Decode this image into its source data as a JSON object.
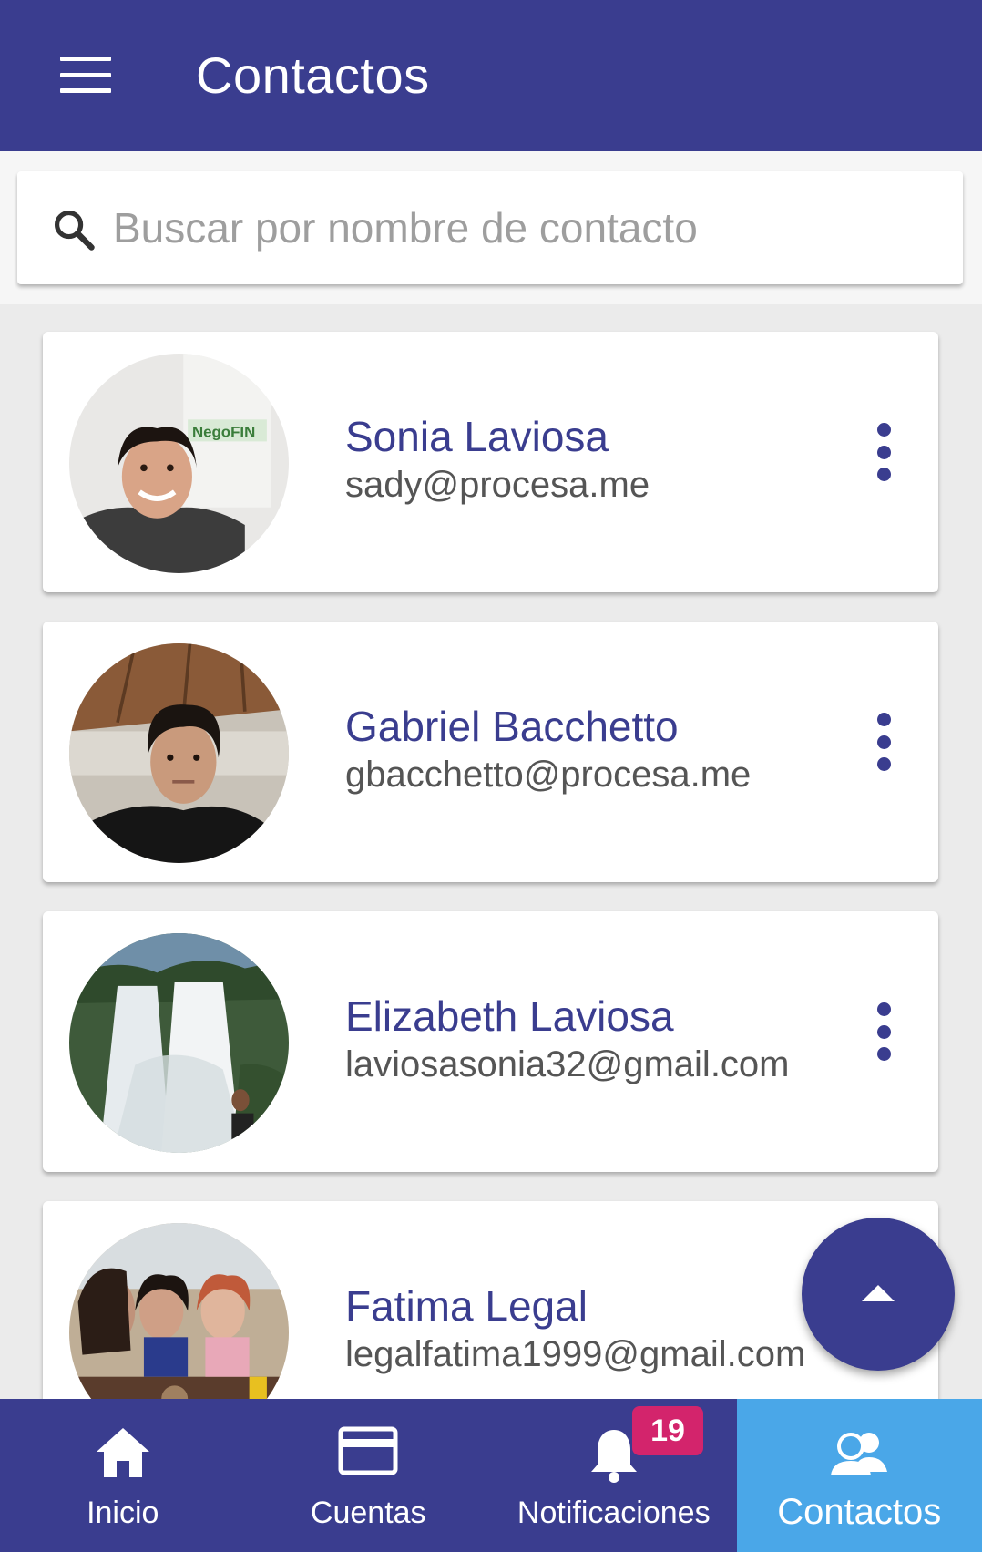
{
  "header": {
    "title": "Contactos",
    "menu_icon": "hamburger-menu-icon"
  },
  "search": {
    "placeholder": "Buscar por nombre de contacto",
    "value": "",
    "icon": "search-icon"
  },
  "contacts": [
    {
      "name": "Sonia Laviosa",
      "email": "sady@procesa.me"
    },
    {
      "name": "Gabriel Bacchetto",
      "email": "gbacchetto@procesa.me"
    },
    {
      "name": "Elizabeth Laviosa",
      "email": "laviosasonia32@gmail.com"
    },
    {
      "name": "Fatima Legal",
      "email": "legalfatima1999@gmail.com"
    }
  ],
  "fab": {
    "icon": "arrow-up-icon"
  },
  "bottom_nav": {
    "items": [
      {
        "label": "Inicio",
        "icon": "home-icon"
      },
      {
        "label": "Cuentas",
        "icon": "credit-card-icon"
      },
      {
        "label": "Notificaciones",
        "icon": "bell-icon",
        "badge": "19"
      },
      {
        "label": "Contactos",
        "icon": "contacts-icon",
        "active": true
      }
    ]
  },
  "colors": {
    "primary": "#3a3d8f",
    "active_tab": "#4aa7e8",
    "badge": "#d3246c",
    "background": "#ebebeb"
  }
}
